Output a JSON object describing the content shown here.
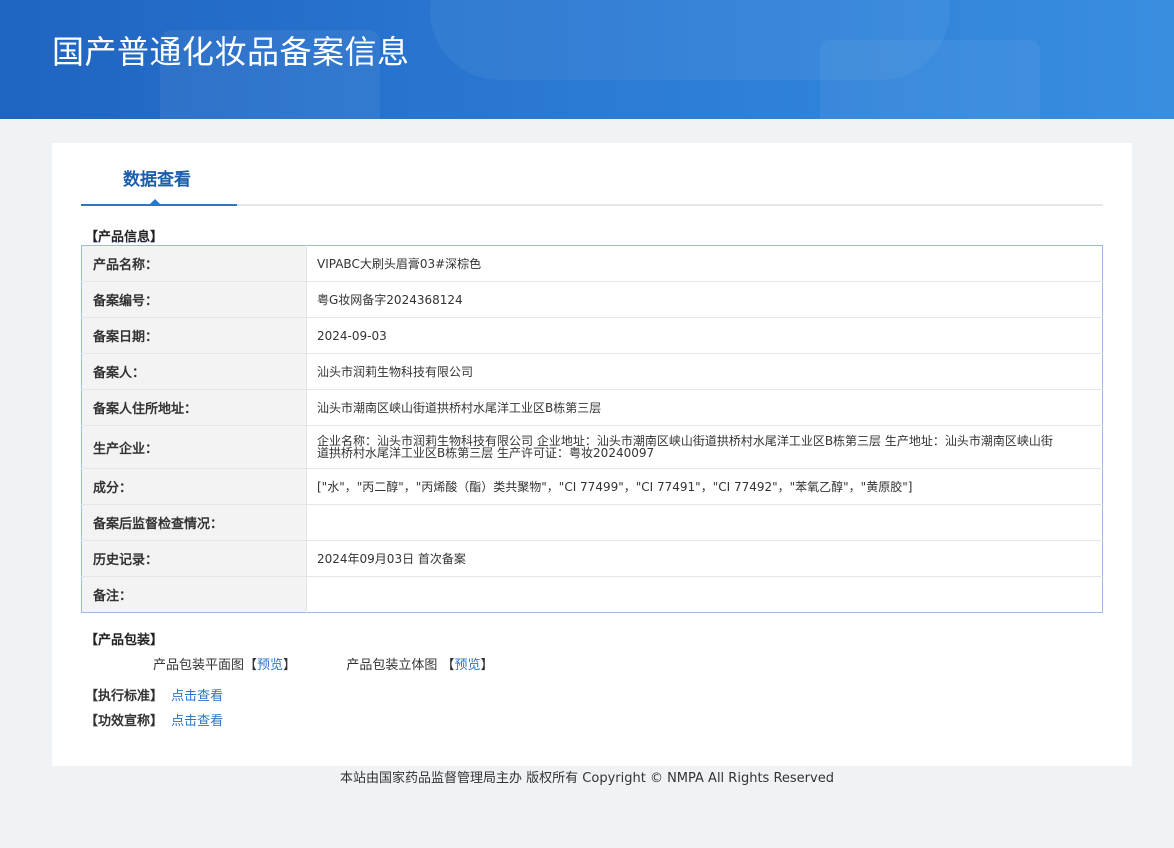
{
  "banner": {
    "title": "国产普通化妆品备案信息"
  },
  "tab": {
    "label": "数据查看"
  },
  "product_info": {
    "section_title": "【产品信息】",
    "rows": [
      {
        "key": "产品名称：",
        "value": "VIPABC大刷头眉膏03#深棕色"
      },
      {
        "key": "备案编号：",
        "value": "粤G妆网备字2024368124"
      },
      {
        "key": "备案日期：",
        "value": "2024-09-03"
      },
      {
        "key": "备案人：",
        "value": "汕头市润莉生物科技有限公司"
      },
      {
        "key": "备案人住所地址：",
        "value": "汕头市潮南区峡山街道拱桥村水尾洋工业区B栋第三层"
      },
      {
        "key": "生产企业：",
        "value": "企业名称：汕头市润莉生物科技有限公司 企业地址：汕头市潮南区峡山街道拱桥村水尾洋工业区B栋第三层 生产地址：汕头市潮南区峡山街道拱桥村水尾洋工业区B栋第三层 生产许可证：粤妆20240097"
      },
      {
        "key": "成分：",
        "value": "[\"水\"，\"丙二醇\"，\"丙烯酸（酯）类共聚物\"，\"CI 77499\"，\"CI 77491\"，\"CI 77492\"，\"苯氧乙醇\"，\"黄原胶\"]"
      },
      {
        "key": "备案后监督检查情况：",
        "value": ""
      },
      {
        "key": "历史记录：",
        "value": "2024年09月03日 首次备案"
      },
      {
        "key": "备注：",
        "value": ""
      }
    ]
  },
  "packaging": {
    "section_title": "【产品包装】",
    "flat_label": "产品包装平面图",
    "solid_label": "产品包装立体图",
    "preview_link": "预览",
    "bracket_open": "【",
    "bracket_close": "】"
  },
  "standard": {
    "section_title": "【执行标准】",
    "link": "点击查看"
  },
  "efficacy": {
    "section_title": "【功效宣称】",
    "link": "点击查看"
  },
  "footer": {
    "text": "本站由国家药品监督管理局主办 版权所有 Copyright © NMPA All Rights Reserved"
  }
}
